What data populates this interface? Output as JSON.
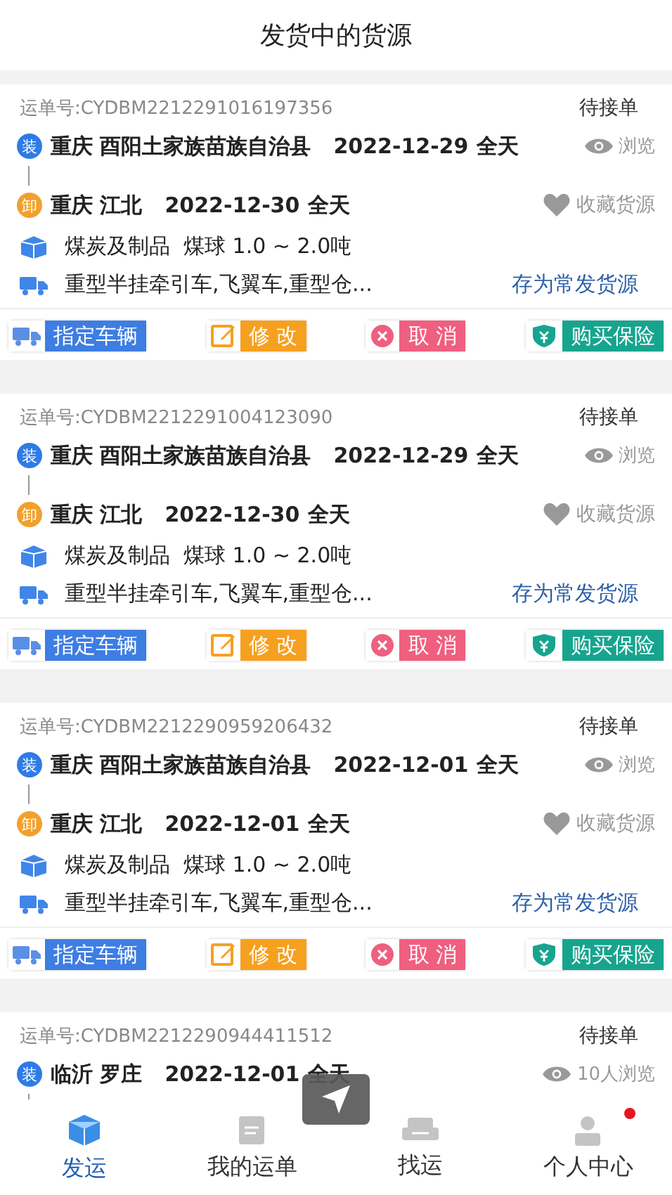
{
  "header": {
    "title": "发货中的货源"
  },
  "cards": [
    {
      "order_no": "运单号:CYDBM2212291016197356",
      "status": "待接单",
      "stops": [
        {
          "kind": "load",
          "badge": "装",
          "place": "重庆 酉阳土家族苗族自治县",
          "date": "2022-12-29",
          "time": "全天"
        },
        {
          "kind": "unload",
          "badge": "卸",
          "place": "重庆 江北",
          "date": "2022-12-30",
          "time": "全天"
        }
      ],
      "views": "浏览",
      "favorite": "收藏货源",
      "cargo": "煤炭及制品  煤球 1.0 ~ 2.0吨",
      "vehicle": "重型半挂牵引车,飞翼车,重型仓...",
      "save": "存为常发货源",
      "actions": [
        {
          "kind": "assign",
          "label": "指定车辆"
        },
        {
          "kind": "edit",
          "label": "修 改"
        },
        {
          "kind": "cancel",
          "label": "取 消"
        },
        {
          "kind": "insurance",
          "label": "购买保险"
        }
      ]
    },
    {
      "order_no": "运单号:CYDBM2212291004123090",
      "status": "待接单",
      "stops": [
        {
          "kind": "load",
          "badge": "装",
          "place": "重庆 酉阳土家族苗族自治县",
          "date": "2022-12-29",
          "time": "全天"
        },
        {
          "kind": "unload",
          "badge": "卸",
          "place": "重庆 江北",
          "date": "2022-12-30",
          "time": "全天"
        }
      ],
      "views": "浏览",
      "favorite": "收藏货源",
      "cargo": "煤炭及制品  煤球 1.0 ~ 2.0吨",
      "vehicle": "重型半挂牵引车,飞翼车,重型仓...",
      "save": "存为常发货源",
      "actions": [
        {
          "kind": "assign",
          "label": "指定车辆"
        },
        {
          "kind": "edit",
          "label": "修 改"
        },
        {
          "kind": "cancel",
          "label": "取 消"
        },
        {
          "kind": "insurance",
          "label": "购买保险"
        }
      ]
    },
    {
      "order_no": "运单号:CYDBM2212290959206432",
      "status": "待接单",
      "stops": [
        {
          "kind": "load",
          "badge": "装",
          "place": "重庆 酉阳土家族苗族自治县",
          "date": "2022-12-01",
          "time": "全天"
        },
        {
          "kind": "unload",
          "badge": "卸",
          "place": "重庆 江北",
          "date": "2022-12-01",
          "time": "全天"
        }
      ],
      "views": "浏览",
      "favorite": "收藏货源",
      "cargo": "煤炭及制品  煤球 1.0 ~ 2.0吨",
      "vehicle": "重型半挂牵引车,飞翼车,重型仓...",
      "save": "存为常发货源",
      "actions": [
        {
          "kind": "assign",
          "label": "指定车辆"
        },
        {
          "kind": "edit",
          "label": "修 改"
        },
        {
          "kind": "cancel",
          "label": "取 消"
        },
        {
          "kind": "insurance",
          "label": "购买保险"
        }
      ]
    },
    {
      "order_no": "运单号:CYDBM2212290944411512",
      "status": "待接单",
      "stops": [
        {
          "kind": "load",
          "badge": "装",
          "place": "临沂 罗庄",
          "date": "2022-12-01",
          "time": "全天"
        }
      ],
      "views": "10人浏览"
    }
  ],
  "nav": [
    {
      "kind": "ship",
      "label": "发运",
      "selected": true,
      "dot": false
    },
    {
      "kind": "orders",
      "label": "我的运单",
      "selected": false,
      "dot": false
    },
    {
      "kind": "find",
      "label": "找运",
      "selected": false,
      "dot": false
    },
    {
      "kind": "me",
      "label": "个人中心",
      "selected": false,
      "dot": true
    }
  ]
}
